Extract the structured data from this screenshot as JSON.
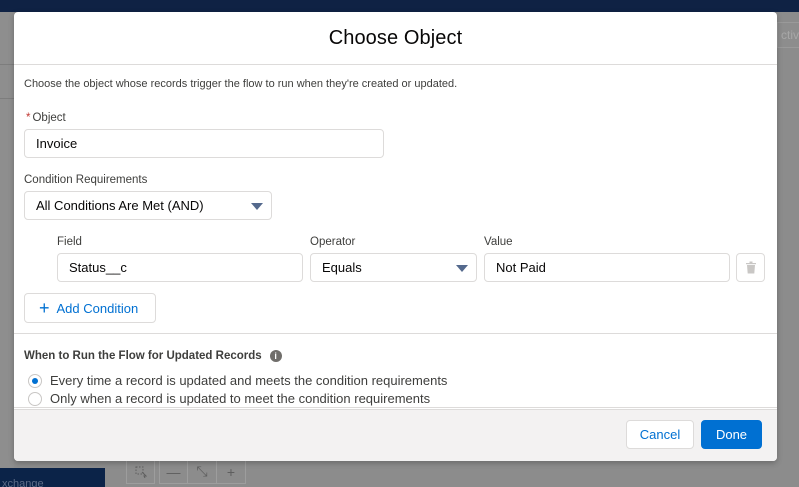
{
  "background": {
    "right_button_text": "ctiva",
    "bottom_tab_text": "xchange",
    "tools": [
      {
        "icon": "pan-hand-icon"
      },
      {
        "icon": "minus-icon",
        "label": "—"
      },
      {
        "icon": "fit-arrows-icon",
        "label": "⤡"
      },
      {
        "icon": "plus-icon",
        "label": "+"
      }
    ]
  },
  "modal": {
    "title": "Choose Object",
    "description": "Choose the object whose records trigger the flow to run when they're created or updated.",
    "object": {
      "required_marker": "*",
      "label": "Object",
      "value": "Invoice"
    },
    "condition_requirements": {
      "label": "Condition Requirements",
      "value": "All Conditions Are Met (AND)"
    },
    "condition": {
      "field_label": "Field",
      "field_value": "Status__c",
      "operator_label": "Operator",
      "operator_value": "Equals",
      "value_label": "Value",
      "value_value": "Not Paid"
    },
    "add_condition_label": "Add Condition",
    "when_to_run": {
      "title": "When to Run the Flow for Updated Records",
      "info_icon": "info-icon",
      "options": [
        {
          "label": "Every time a record is updated and meets the condition requirements",
          "selected": true
        },
        {
          "label": "Only when a record is updated to meet the condition requirements",
          "selected": false
        }
      ]
    },
    "footer": {
      "cancel_label": "Cancel",
      "done_label": "Done"
    }
  },
  "colors": {
    "brand": "#0070d2",
    "nav_dark": "#0f2244",
    "required": "#c23934"
  }
}
